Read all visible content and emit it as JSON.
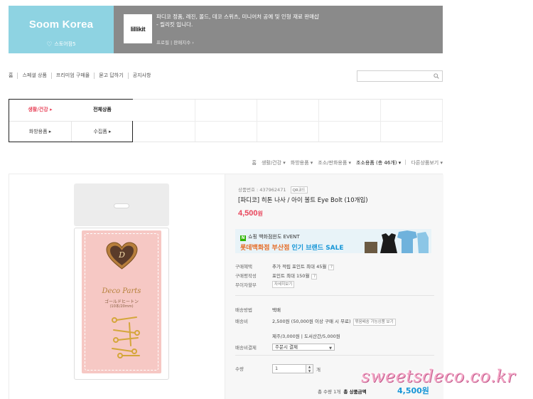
{
  "shop": {
    "brand_title": "Soom Korea",
    "brand_sub": "스토어팜5",
    "logo_text": "lillikit",
    "description": "파디코 정품, 레진, 몰드, 데코 스위츠, 미니어처 공예 및 인형 재료 판매샵 - 릴리킷 입니다.",
    "meta": "프로필 | 판매지수 ›"
  },
  "nav": {
    "items": [
      "홈",
      "스페셜 상품",
      "프리미엄 구매몰",
      "묻고 답하기",
      "공지사항"
    ],
    "search_placeholder": ""
  },
  "categories": {
    "tab_health": "생활/건강 ▸",
    "tab_all": "전체상품",
    "sub1": "화방용품 ▸",
    "sub2": "수집품 ▸"
  },
  "breadcrumb": {
    "items": [
      "홈",
      "생활/건강 ▾",
      "화방용품 ▾",
      "조소/판화용품 ▾",
      "조소용품 (총 46개) ▾"
    ],
    "more": "다른상품보기 ▾"
  },
  "product": {
    "code_label": "상품번호 : 437962471",
    "qr_label": "QR코드",
    "name": "[파디코] 히톤 나사 / 아이 볼트 Eye Bolt (10개입)",
    "price": "4,500",
    "price_unit": "원",
    "package": {
      "brand": "Deco Parts",
      "jp": "ゴールドヒートン",
      "size": "(10本/20mm)"
    }
  },
  "event": {
    "line1": "쇼핑 백화점윈도 EVENT",
    "line2_a": "롯데백화점",
    "line2_b": "부산점",
    "line2_c": "인기 브랜드 SALE",
    "n_icon": "N"
  },
  "info": {
    "rows": [
      {
        "k": "구매혜택",
        "v": "추가 적립 포인트 최대 45월"
      },
      {
        "k": "구매평작성",
        "v": "포인트 최대 150월"
      },
      {
        "k": "무이자할부",
        "v": ""
      },
      {
        "k": "배송방법",
        "v": "택배"
      },
      {
        "k": "배송비",
        "v": "2,500원  (50,000원 이상 구매 시 무료)"
      },
      {
        "k": "",
        "v": "제주/3,000원 | 도서산간/5,000원"
      },
      {
        "k": "배송비결제",
        "v": ""
      },
      {
        "k": "수량",
        "v": ""
      }
    ],
    "installment_btn": "자세히보기",
    "shipping_btn": "묶음배송 가능상품 보기",
    "payment_select": "주문시 결제",
    "qty_value": "1",
    "qty_unit": "개"
  },
  "total": {
    "count_text": "총 수량 1개",
    "label": "총 상품금액",
    "price": "4,500원"
  },
  "watermark": "sweetsdeco.co.kr"
}
